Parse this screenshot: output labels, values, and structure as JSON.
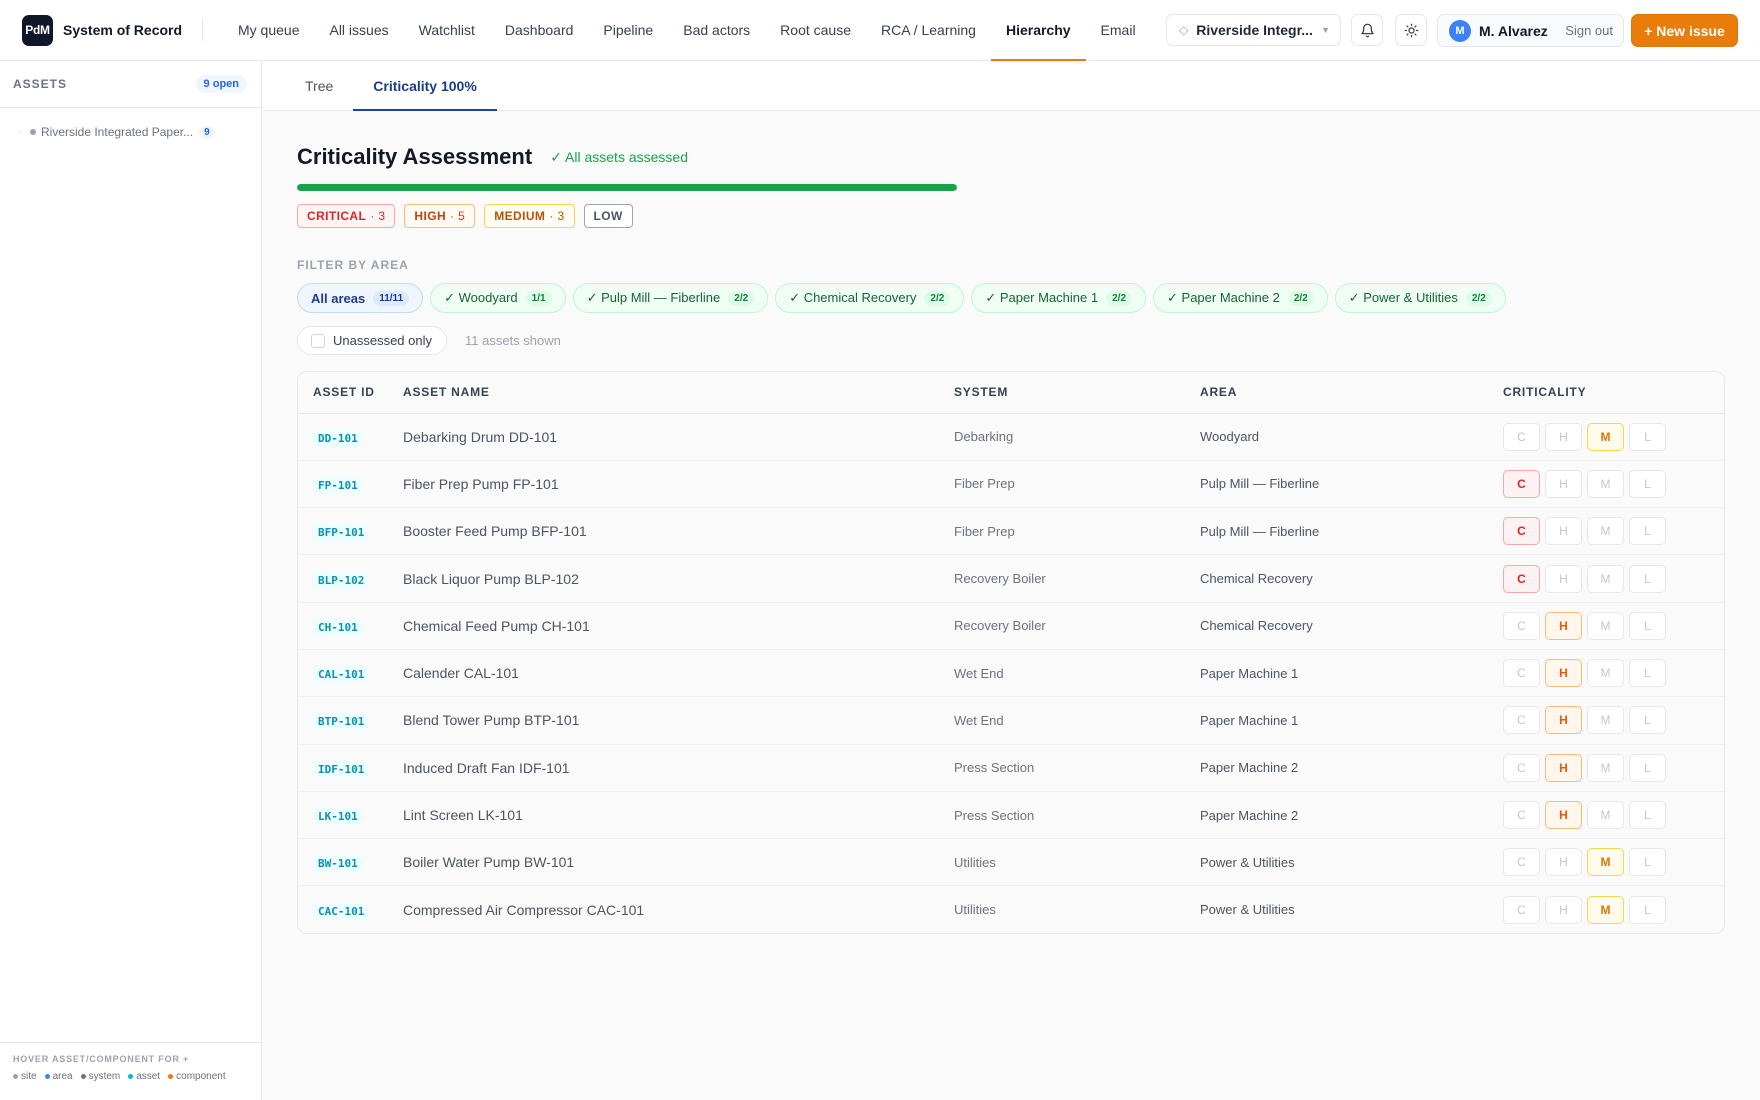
{
  "app": {
    "logo_text": "PdM",
    "title": "System of Record"
  },
  "nav": [
    {
      "label": "My queue",
      "active": false
    },
    {
      "label": "All issues",
      "active": false
    },
    {
      "label": "Watchlist",
      "active": false
    },
    {
      "label": "Dashboard",
      "active": false
    },
    {
      "label": "Pipeline",
      "active": false
    },
    {
      "label": "Bad actors",
      "active": false
    },
    {
      "label": "Root cause",
      "active": false
    },
    {
      "label": "RCA / Learning",
      "active": false
    },
    {
      "label": "Hierarchy",
      "active": true
    },
    {
      "label": "Email",
      "active": false
    }
  ],
  "site_select": {
    "icon": "pin-icon",
    "label": "Riverside Integr..."
  },
  "toolbar_icons": [
    "bell-icon",
    "sun-icon"
  ],
  "user": {
    "initial": "M",
    "name": "M. Alvarez",
    "signout_label": "Sign out"
  },
  "new_issue_label": "+ New issue",
  "sidebar": {
    "title": "ASSETS",
    "open_badge": "9 open",
    "tree": [
      {
        "label": "Riverside Integrated Paper...",
        "count": "9"
      }
    ],
    "footer_hint": "HOVER ASSET/COMPONENT FOR +",
    "legend": [
      {
        "label": "site",
        "color": "#9ca3af"
      },
      {
        "label": "area",
        "color": "#3b82f6"
      },
      {
        "label": "system",
        "color": "#6b7280"
      },
      {
        "label": "asset",
        "color": "#06b6d4"
      },
      {
        "label": "component",
        "color": "#f97316"
      }
    ]
  },
  "tabs": [
    {
      "label": "Tree",
      "active": false
    },
    {
      "label": "Criticality 100%",
      "active": true
    }
  ],
  "main": {
    "title": "Criticality Assessment",
    "assessed_text": "✓ All assets assessed",
    "progress_fraction": 1.0,
    "severity_summary": [
      {
        "key": "critical",
        "label": "CRITICAL",
        "count": "· 3"
      },
      {
        "key": "high",
        "label": "HIGH",
        "count": "· 5"
      },
      {
        "key": "medium",
        "label": "MEDIUM",
        "count": "· 3"
      },
      {
        "key": "low",
        "label": "LOW",
        "count": ""
      }
    ],
    "filter_label": "FILTER BY AREA",
    "area_chips": [
      {
        "label": "All areas",
        "count": "11/11",
        "kind": "all"
      },
      {
        "label": "✓ Woodyard",
        "count": "1/1",
        "kind": "area"
      },
      {
        "label": "✓ Pulp Mill — Fiberline",
        "count": "2/2",
        "kind": "area"
      },
      {
        "label": "✓ Chemical Recovery",
        "count": "2/2",
        "kind": "area"
      },
      {
        "label": "✓ Paper Machine 1",
        "count": "2/2",
        "kind": "area"
      },
      {
        "label": "✓ Paper Machine 2",
        "count": "2/2",
        "kind": "area"
      },
      {
        "label": "✓ Power & Utilities",
        "count": "2/2",
        "kind": "area"
      }
    ],
    "unassessed_label": "Unassessed only",
    "shown_text": "11 assets shown",
    "columns": [
      "ASSET ID",
      "ASSET NAME",
      "SYSTEM",
      "AREA",
      "CRITICALITY"
    ],
    "criticality_levels": [
      "C",
      "H",
      "M",
      "L"
    ],
    "rows": [
      {
        "id": "DD-101",
        "name": "Debarking Drum DD-101",
        "system": "Debarking",
        "area": "Woodyard",
        "crit": "M"
      },
      {
        "id": "FP-101",
        "name": "Fiber Prep Pump FP-101",
        "system": "Fiber Prep",
        "area": "Pulp Mill — Fiberline",
        "crit": "C"
      },
      {
        "id": "BFP-101",
        "name": "Booster Feed Pump BFP-101",
        "system": "Fiber Prep",
        "area": "Pulp Mill — Fiberline",
        "crit": "C"
      },
      {
        "id": "BLP-102",
        "name": "Black Liquor Pump BLP-102",
        "system": "Recovery Boiler",
        "area": "Chemical Recovery",
        "crit": "C"
      },
      {
        "id": "CH-101",
        "name": "Chemical Feed Pump CH-101",
        "system": "Recovery Boiler",
        "area": "Chemical Recovery",
        "crit": "H"
      },
      {
        "id": "CAL-101",
        "name": "Calender CAL-101",
        "system": "Wet End",
        "area": "Paper Machine 1",
        "crit": "H"
      },
      {
        "id": "BTP-101",
        "name": "Blend Tower Pump BTP-101",
        "system": "Wet End",
        "area": "Paper Machine 1",
        "crit": "H"
      },
      {
        "id": "IDF-101",
        "name": "Induced Draft Fan IDF-101",
        "system": "Press Section",
        "area": "Paper Machine 2",
        "crit": "H"
      },
      {
        "id": "LK-101",
        "name": "Lint Screen LK-101",
        "system": "Press Section",
        "area": "Paper Machine 2",
        "crit": "H"
      },
      {
        "id": "BW-101",
        "name": "Boiler Water Pump BW-101",
        "system": "Utilities",
        "area": "Power & Utilities",
        "crit": "M"
      },
      {
        "id": "CAC-101",
        "name": "Compressed Air Compressor CAC-101",
        "system": "Utilities",
        "area": "Power & Utilities",
        "crit": "M"
      }
    ]
  }
}
